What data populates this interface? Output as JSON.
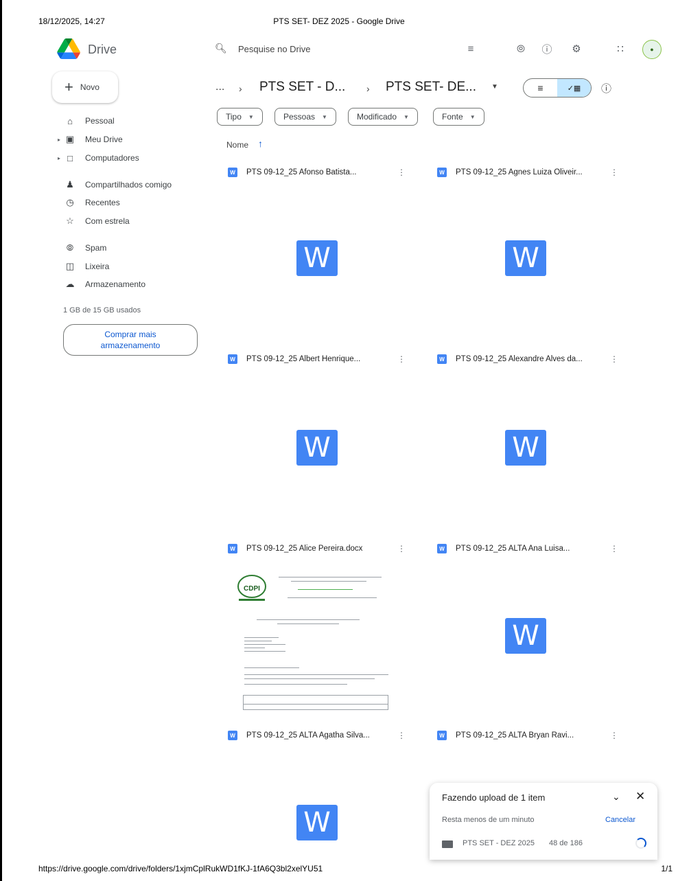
{
  "print": {
    "datetime": "18/12/2025, 14:27",
    "title": "PTS SET- DEZ 2025 - Google Drive",
    "url": "https://drive.google.com/drive/folders/1xjmCplRukWD1fKJ-1fA6Q3bl2xelYU51",
    "page": "1/1"
  },
  "header": {
    "app_name": "Drive",
    "search_placeholder": "Pesquise no Drive",
    "icons": [
      "search-options-icon",
      "offline-status-icon",
      "help-icon",
      "settings-icon",
      "apps-grid-icon",
      "account-avatar"
    ]
  },
  "sidebar": {
    "new_label": "Novo",
    "items": [
      {
        "label": "Pessoal",
        "icon": "home-icon"
      },
      {
        "label": "Meu Drive",
        "icon": "my-drive-icon"
      },
      {
        "label": "Computadores",
        "icon": "computers-icon"
      },
      {
        "label": "Compartilhados comigo",
        "icon": "shared-icon"
      },
      {
        "label": "Recentes",
        "icon": "recent-icon"
      },
      {
        "label": "Com estrela",
        "icon": "star-icon"
      },
      {
        "label": "Spam",
        "icon": "spam-icon"
      },
      {
        "label": "Lixeira",
        "icon": "trash-icon"
      },
      {
        "label": "Armazenamento",
        "icon": "cloud-icon"
      }
    ],
    "storage_text": "1 GB de 15 GB usados",
    "buy_storage": "Comprar mais armazenamento"
  },
  "breadcrumb": {
    "more": "...",
    "items": [
      "PTS SET - D...",
      "PTS SET- DE..."
    ]
  },
  "filters": [
    "Tipo",
    "Pessoas",
    "Modificado",
    "Fonte"
  ],
  "sort": {
    "label": "Nome",
    "direction": "ascending"
  },
  "files": [
    {
      "name": "PTS 09-12_25 Afonso Batista..."
    },
    {
      "name": "PTS 09-12_25 Agnes Luiza Oliveir..."
    },
    {
      "name": "PTS 09-12_25 Albert Henrique..."
    },
    {
      "name": "PTS 09-12_25 Alexandre Alves da..."
    },
    {
      "name": "PTS 09-12_25 Alice Pereira.docx"
    },
    {
      "name": "PTS 09-12_25 ALTA Ana Luisa..."
    },
    {
      "name": "PTS 09-12_25 ALTA Agatha Silva..."
    },
    {
      "name": "PTS 09-12_25 ALTA Bryan Ravi..."
    }
  ],
  "thumbnail": {
    "letter": "W"
  },
  "preview_doc": {
    "logo_text": "CDPI"
  },
  "upload": {
    "title": "Fazendo upload de 1 item",
    "subtitle": "Resta menos de um minuto",
    "cancel": "Cancelar",
    "folder_name": "PTS SET - DEZ 2025",
    "progress": "48 de 186"
  }
}
